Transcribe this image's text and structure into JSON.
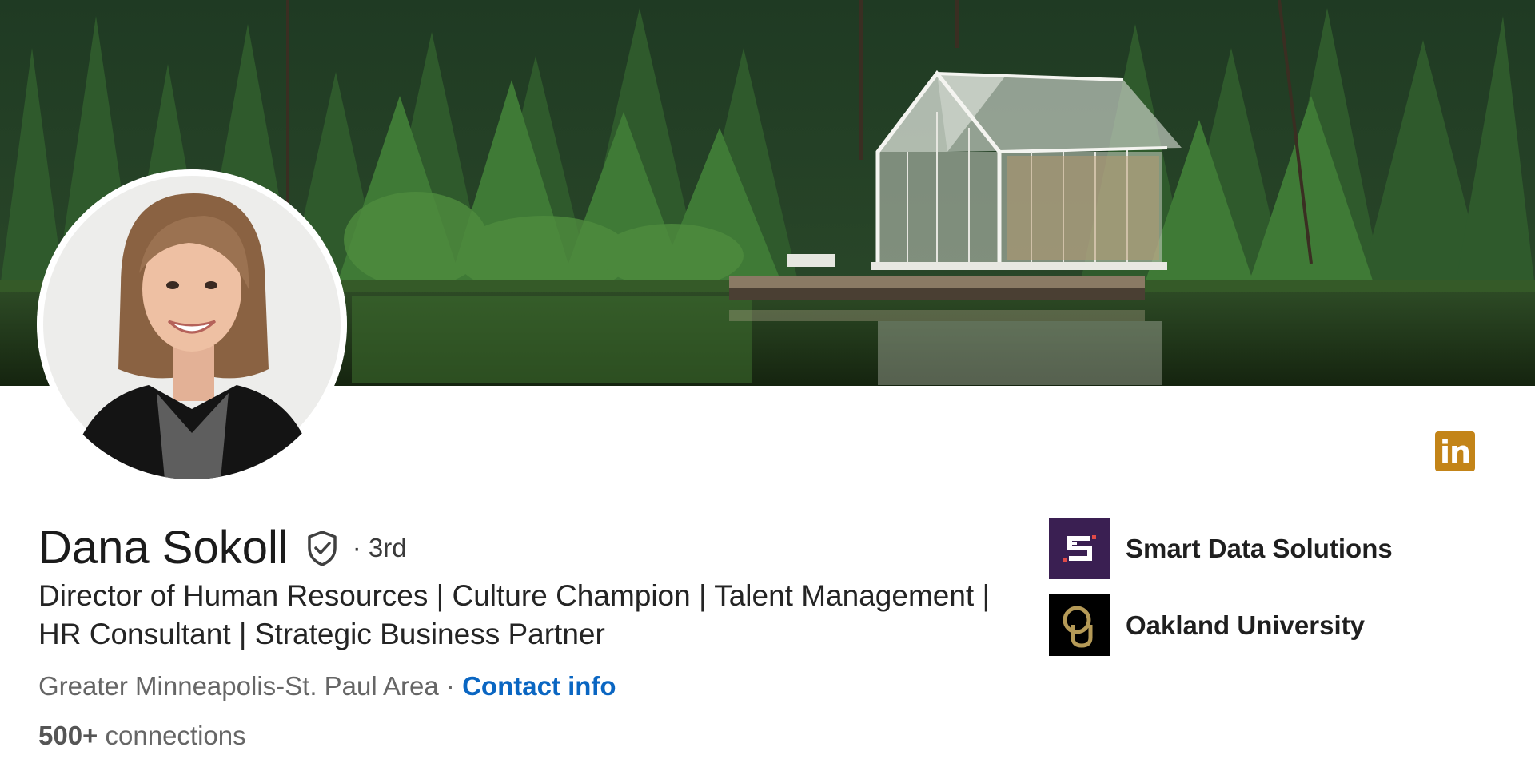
{
  "profile": {
    "name": "Dana Sokoll",
    "degree": "· 3rd",
    "headline": "Director of Human Resources | Culture Champion | Talent Management | HR Consultant | Strategic Business Partner",
    "location": "Greater Minneapolis-St. Paul Area ·",
    "contact_label": "Contact info",
    "connections_count": "500+",
    "connections_label": "connections"
  },
  "orgs": [
    {
      "name": "Smart Data Solutions",
      "icon": "smart-data-solutions-logo"
    },
    {
      "name": "Oakland University",
      "icon": "oakland-university-logo"
    }
  ],
  "brand": {
    "linkedin_text": "in",
    "linkedin_color": "#c38418",
    "link_color": "#0a66c2"
  },
  "icons": {
    "verified": "shield-check-icon"
  }
}
